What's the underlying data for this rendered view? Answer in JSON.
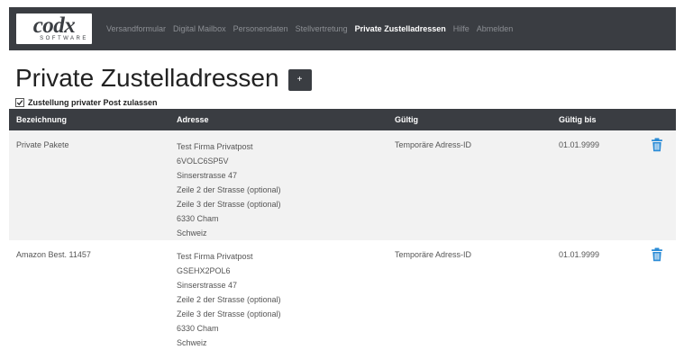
{
  "colors": {
    "navbar_bg": "#3a3d42",
    "accent": "#2a8bd6",
    "row_alt": "#f2f2f2"
  },
  "logo": {
    "word": "codx",
    "sub": "SOFTWARE"
  },
  "nav": {
    "items": [
      {
        "label": "Versandformular",
        "active": false
      },
      {
        "label": "Digital Mailbox",
        "active": false
      },
      {
        "label": "Personendaten",
        "active": false
      },
      {
        "label": "Stellvertretung",
        "active": false
      },
      {
        "label": "Private Zustelladressen",
        "active": true
      },
      {
        "label": "Hilfe",
        "active": false
      },
      {
        "label": "Abmelden",
        "active": false
      }
    ]
  },
  "page": {
    "title": "Private Zustelladressen",
    "add_button_label": "+",
    "checkbox_label": "Zustellung privater Post zulassen",
    "checkbox_checked": true
  },
  "table": {
    "headers": [
      "Bezeichnung",
      "Adresse",
      "Gültig",
      "Gültig bis"
    ],
    "rows": [
      {
        "bezeichnung": "Private Pakete",
        "adresse": [
          "Test Firma Privatpost",
          "6VOLC6SP5V",
          "Sinserstrasse 47",
          "Zeile 2 der Strasse (optional)",
          "Zeile 3 der Strasse (optional)",
          "6330 Cham",
          "Schweiz"
        ],
        "gueltig": "Temporäre Adress-ID",
        "gueltig_bis": "01.01.9999",
        "delete_icon": "trash-icon"
      },
      {
        "bezeichnung": "Amazon Best. 11457",
        "adresse": [
          "Test Firma Privatpost",
          "GSEHX2POL6",
          "Sinserstrasse 47",
          "Zeile 2 der Strasse (optional)",
          "Zeile 3 der Strasse (optional)",
          "6330 Cham",
          "Schweiz"
        ],
        "gueltig": "Temporäre Adress-ID",
        "gueltig_bis": "01.01.9999",
        "delete_icon": "trash-icon"
      }
    ]
  }
}
